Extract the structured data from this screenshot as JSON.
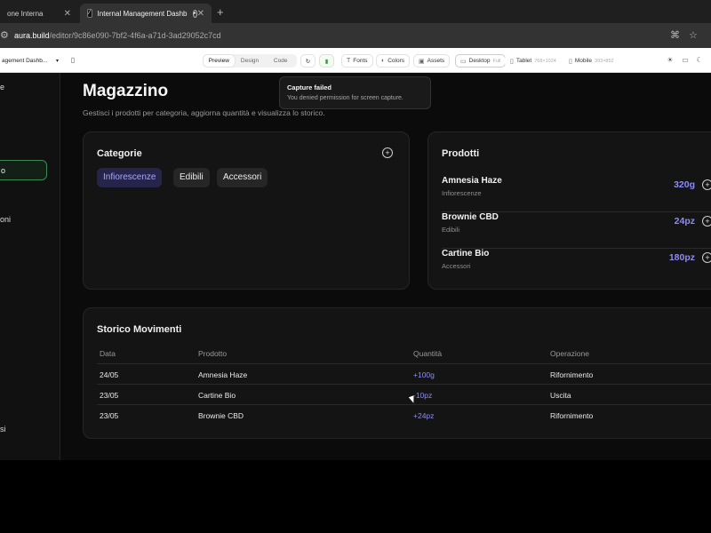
{
  "browser": {
    "tabs": [
      {
        "label": "one Interna"
      },
      {
        "label": "Internal Management Dashb"
      }
    ],
    "url_host": "aura.build",
    "url_path": "/editor/9c86e090-7bf2-4f6a-a71d-3ad29052c7cd"
  },
  "toolbar": {
    "project_name": "agement Dashb...",
    "segments": [
      "Preview",
      "Design",
      "Code"
    ],
    "active_segment": "Preview",
    "fonts_label": "Fonts",
    "colors_label": "Colors",
    "assets_label": "Assets",
    "devices": [
      {
        "label": "Desktop",
        "sub": "Full"
      },
      {
        "label": "Tablet",
        "sub": "768×1024"
      },
      {
        "label": "Mobile",
        "sub": "393×852"
      }
    ]
  },
  "sidebar": {
    "items": [
      {
        "label": "e"
      },
      {
        "label": "o"
      },
      {
        "label": "oni"
      },
      {
        "label": "si"
      }
    ]
  },
  "page": {
    "title": "Magazzino",
    "subtitle": "Gestisci i prodotti per categoria, aggiorna quantità e visualizza lo storico."
  },
  "categories": {
    "title": "Categorie",
    "chips": [
      "Infiorescenze",
      "Edibili",
      "Accessori"
    ]
  },
  "products": {
    "title": "Prodotti",
    "items": [
      {
        "name": "Amnesia Haze",
        "category": "Infiorescenze",
        "qty": "320g"
      },
      {
        "name": "Brownie CBD",
        "category": "Edibili",
        "qty": "24pz"
      },
      {
        "name": "Cartine Bio",
        "category": "Accessori",
        "qty": "180pz"
      }
    ]
  },
  "history": {
    "title": "Storico Movimenti",
    "headers": [
      "Data",
      "Prodotto",
      "Quantità",
      "Operazione"
    ],
    "rows": [
      [
        "24/05",
        "Amnesia Haze",
        "+100g",
        "Rifornimento"
      ],
      [
        "23/05",
        "Cartine Bio",
        "-10pz",
        "Uscita"
      ],
      [
        "23/05",
        "Brownie CBD",
        "+24pz",
        "Rifornimento"
      ]
    ]
  },
  "toast": {
    "title": "Capture failed",
    "message": "You denied permission for screen capture."
  }
}
